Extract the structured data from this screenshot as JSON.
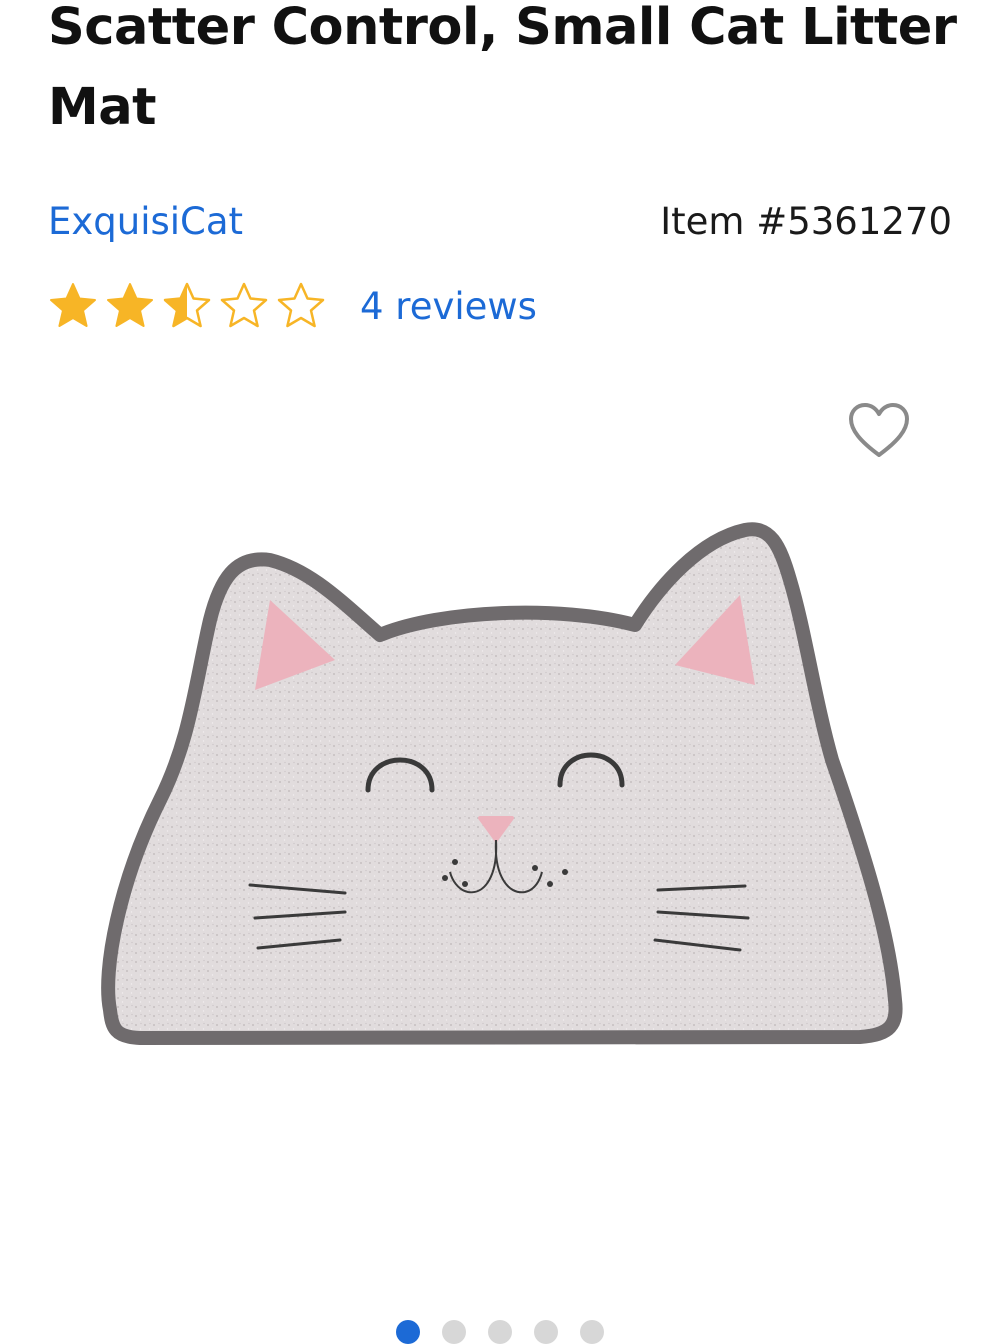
{
  "product": {
    "title": "Scatter Control, Small Cat Litter Mat",
    "brand": "ExquisiCat",
    "item_number": "Item #5361270",
    "rating": 2.5,
    "rating_max": 5,
    "reviews_label": "4 reviews"
  },
  "icons": {
    "star": "star-icon",
    "favorite": "heart-icon"
  },
  "gallery": {
    "image_count": 5,
    "active_index": 0
  },
  "colors": {
    "link": "#1c6ad6",
    "star": "#f7b526",
    "active_dot": "#1c6ad6",
    "inactive_dot": "#d7d7d7"
  }
}
